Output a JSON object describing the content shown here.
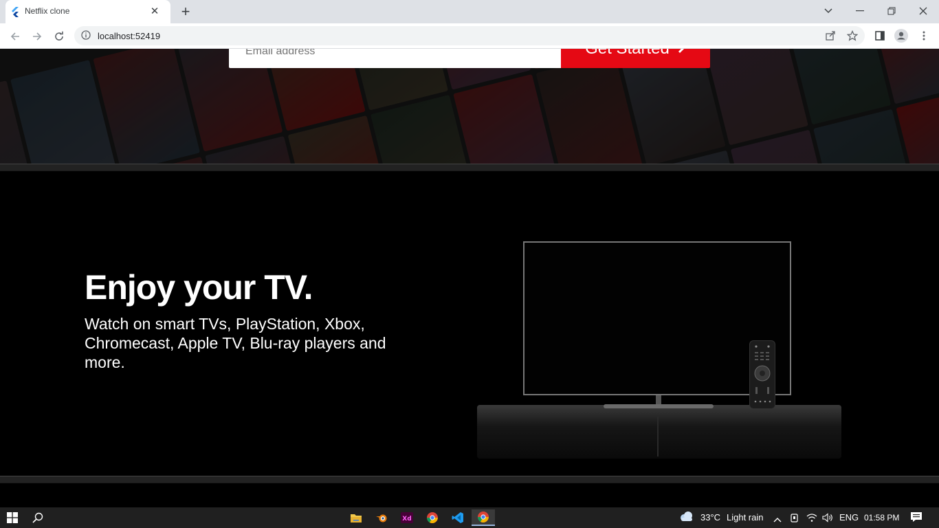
{
  "browser": {
    "tab_title": "Netflix clone",
    "new_tab_symbol": "+",
    "url": "localhost:52419",
    "icons": [
      "flutter-favicon",
      "back-icon",
      "forward-icon",
      "reload-icon",
      "info-icon",
      "share-icon",
      "star-icon",
      "sidebar-icon",
      "profile-icon",
      "menu-dots-icon",
      "chevron-down-icon",
      "minimize-icon",
      "restore-icon",
      "close-icon"
    ]
  },
  "hero": {
    "email_placeholder": "Email address",
    "get_started_label": "Get Started",
    "get_started_arrow": "›"
  },
  "tv_section": {
    "title": "Enjoy your TV.",
    "subtitle": "Watch on smart TVs, PlayStation, Xbox, Chromecast, Apple TV, Blu-ray players and more."
  },
  "taskbar": {
    "apps": [
      "windows-start-icon",
      "search-icon",
      "file-explorer-icon",
      "blender-icon",
      "adobe-xd-icon",
      "chrome-icon",
      "vscode-icon",
      "chrome-active-icon"
    ],
    "weather_temp": "33°C",
    "weather_desc": "Light rain",
    "language": "ENG",
    "time": "01:58 PM"
  },
  "colors": {
    "netflix_red": "#e50914",
    "page_bg": "#000000",
    "divider": "#222222"
  }
}
